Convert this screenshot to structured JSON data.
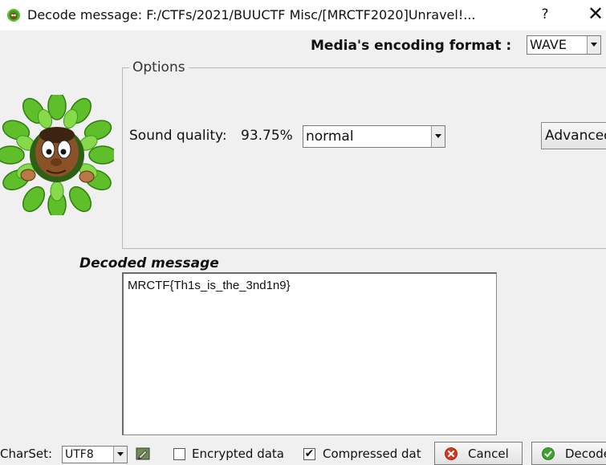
{
  "window": {
    "title": "Decode message: F:/CTFs/2021/BUUCTF Misc/[MRCTF2020]Unravel!...",
    "help_label": "?",
    "close_label": "✕",
    "icon": "mascot-app-icon"
  },
  "header": {
    "format_label": "Media's encoding format :",
    "format_value": "WAVE"
  },
  "options": {
    "legend": "Options",
    "sound_quality_label": "Sound quality:",
    "sound_quality_value": "93.75%",
    "quality_select": "normal",
    "advanced_label": "Advanced"
  },
  "decoded": {
    "heading": "Decoded message",
    "text": "MRCTF{Th1s_is_the_3nd1n9}"
  },
  "footer": {
    "charset_label": "CharSet:",
    "charset_value": "UTF8",
    "pen_icon": "pen-icon",
    "encrypted_label": "Encrypted data",
    "encrypted_checked": false,
    "compressed_label": "Compressed dat",
    "compressed_checked": true,
    "compressed_mark": "✔",
    "cancel_label": "Cancel",
    "decode_label": "Decode"
  },
  "colors": {
    "background": "#f0f0f0",
    "leaf_green": "#5fbf2a",
    "cancel_red": "#d9361b",
    "decode_green": "#3aa52a"
  }
}
